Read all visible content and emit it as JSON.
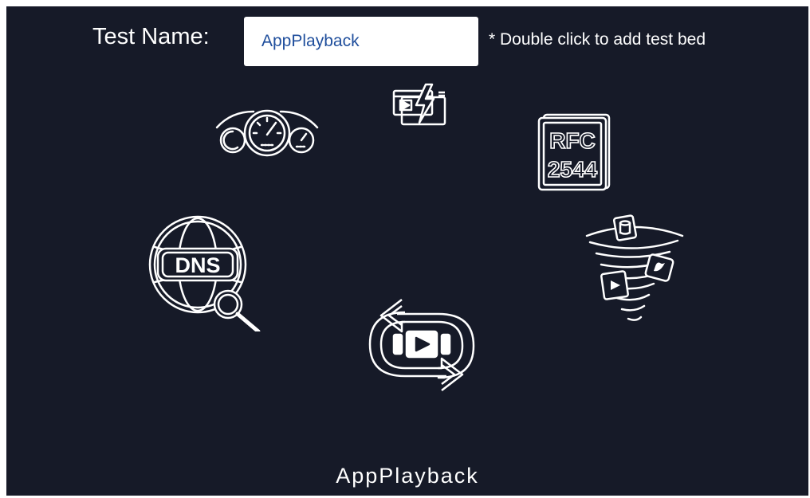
{
  "form": {
    "label": "Test Name:",
    "value": "AppPlayback",
    "hint": "* Double click to add test bed"
  },
  "icons": [
    {
      "name": "speedometer-icon"
    },
    {
      "name": "video-lightning-icon"
    },
    {
      "name": "rfc-document-icon",
      "line1": "RFC",
      "line2": "2544"
    },
    {
      "name": "dns-globe-icon",
      "text": "DNS"
    },
    {
      "name": "app-tornado-icon"
    },
    {
      "name": "app-playback-icon"
    }
  ],
  "selected": {
    "label": "AppPlayback"
  },
  "colors": {
    "panel": "#161a28",
    "input_text": "#1f4e9c",
    "foreground": "#ffffff"
  }
}
